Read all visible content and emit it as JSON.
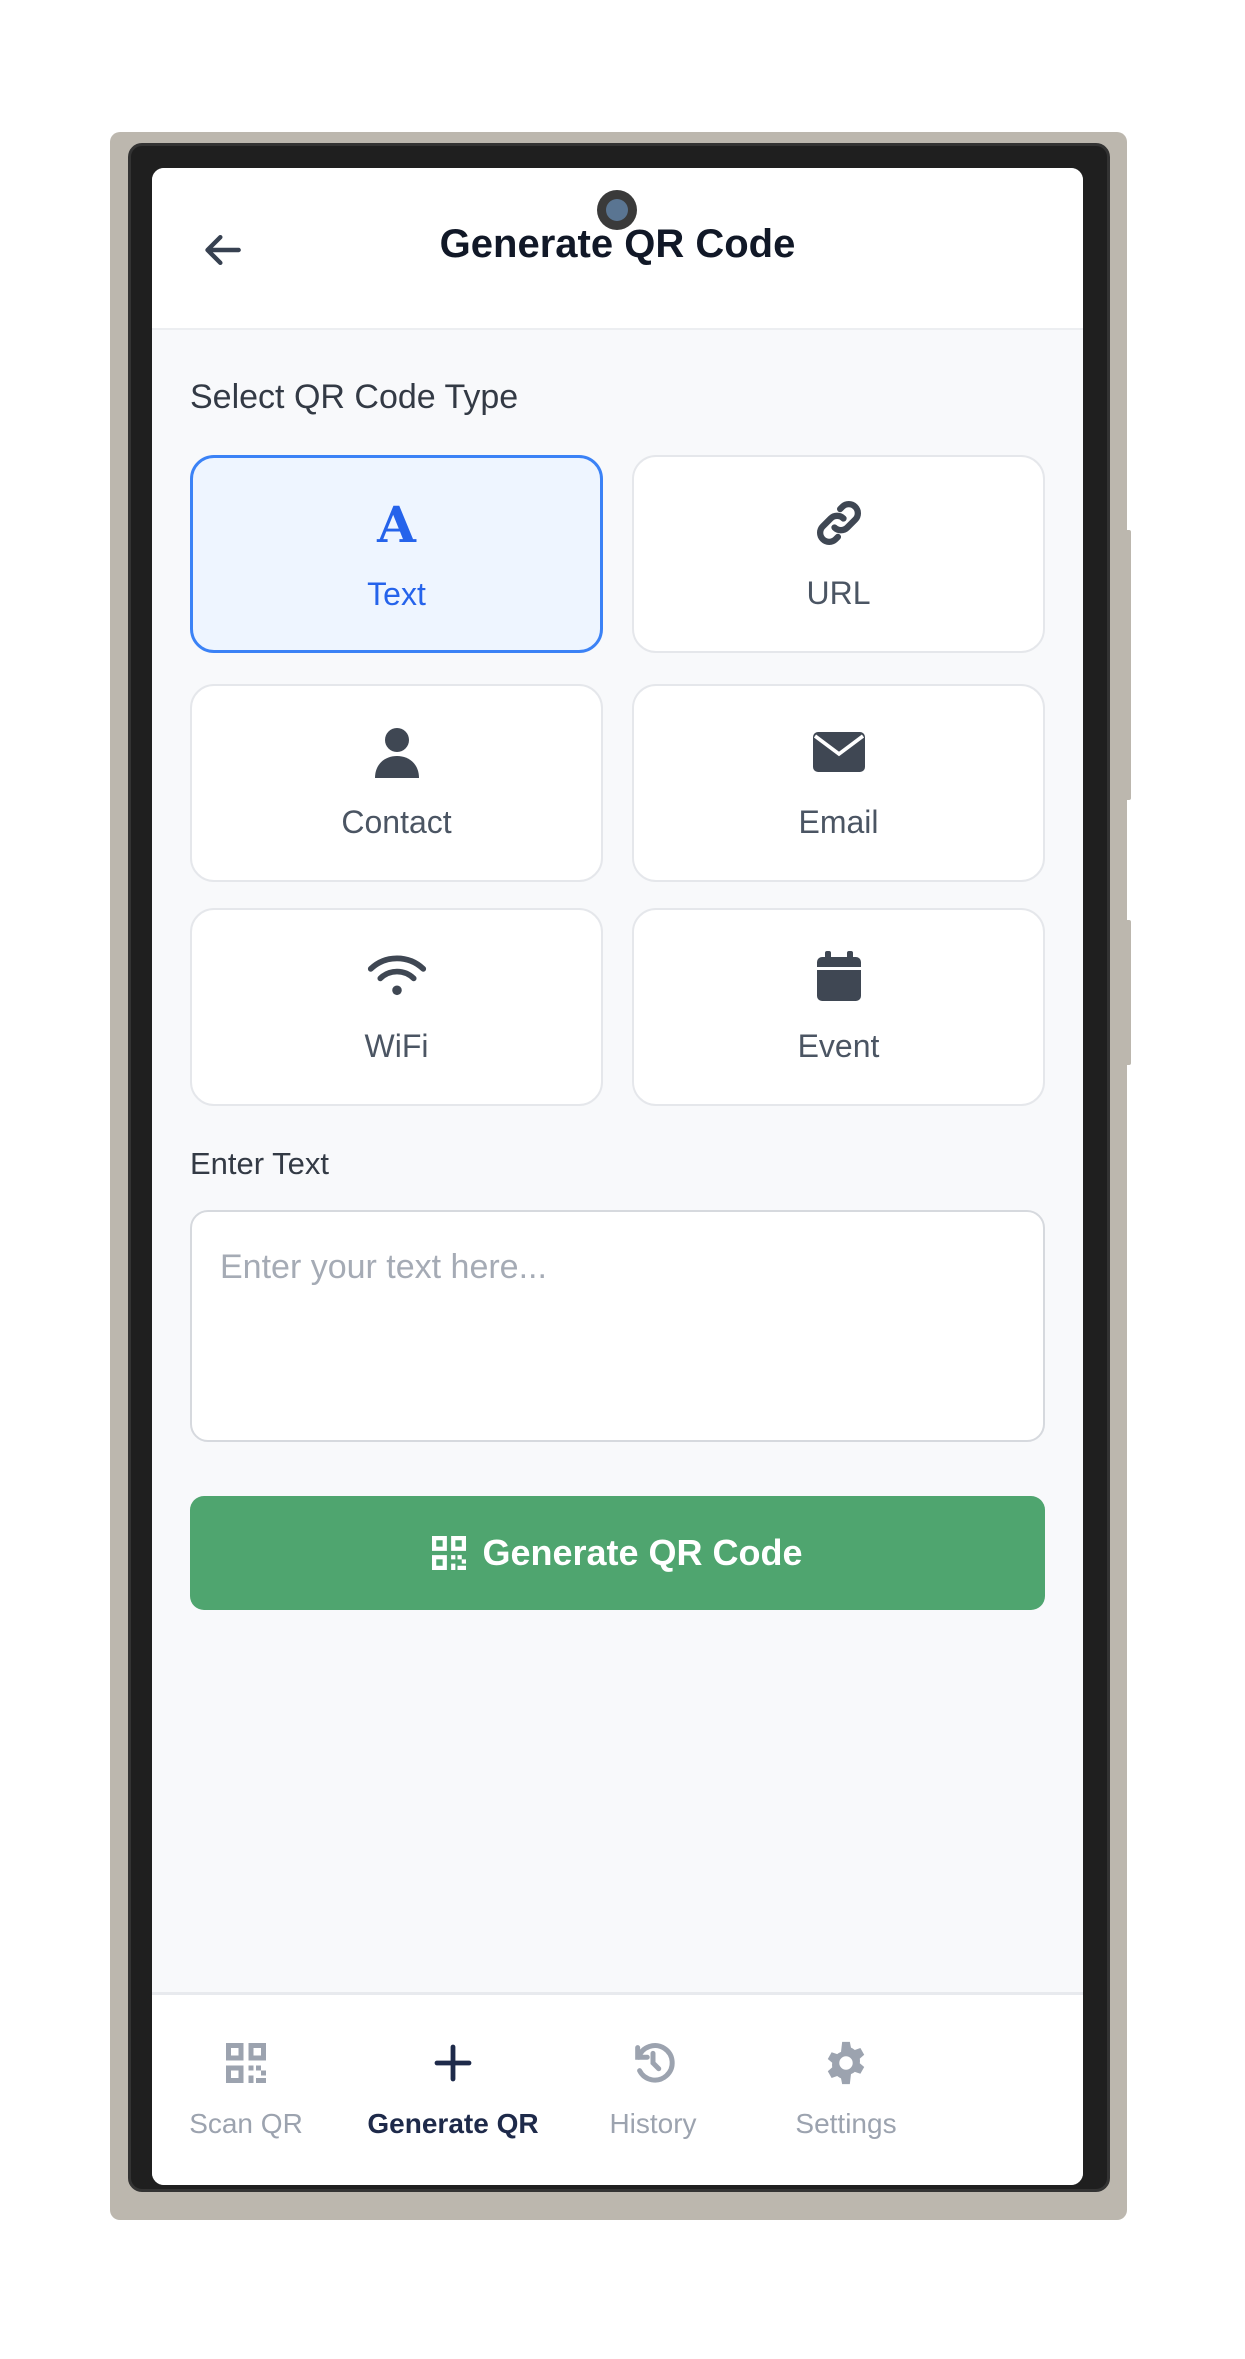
{
  "header": {
    "title": "Generate QR Code"
  },
  "type_section": {
    "label": "Select QR Code Type"
  },
  "types": [
    {
      "label": "Text",
      "icon": "text-icon",
      "selected": true
    },
    {
      "label": "URL",
      "icon": "link-icon"
    },
    {
      "label": "Contact",
      "icon": "user-icon"
    },
    {
      "label": "Email",
      "icon": "envelope-icon"
    },
    {
      "label": "WiFi",
      "icon": "wifi-icon"
    },
    {
      "label": "Event",
      "icon": "calendar-icon"
    }
  ],
  "input": {
    "label": "Enter Text",
    "placeholder": "Enter your text here...",
    "value": ""
  },
  "generate_button": {
    "label": "Generate QR Code"
  },
  "nav": [
    {
      "label": "Scan QR"
    },
    {
      "label": "Generate QR",
      "active": true
    },
    {
      "label": "History"
    },
    {
      "label": "Settings"
    }
  ],
  "colors": {
    "accent": "#3b82f6",
    "button": "#4fa56f",
    "active_nav": "#1e2a4a"
  }
}
